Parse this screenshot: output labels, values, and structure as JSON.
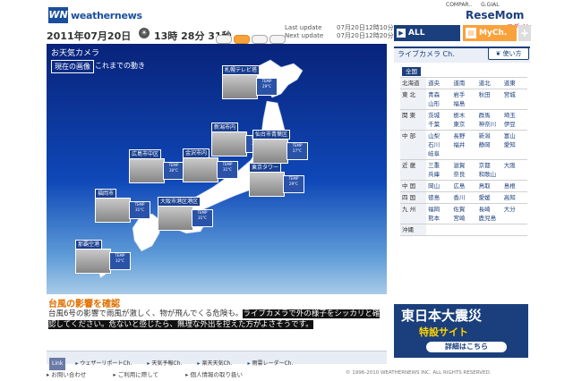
{
  "header": {
    "logo_mark": "WN",
    "logo_text": "weathernews",
    "top_links": [
      "COMPAR..",
      "G.GIAL"
    ],
    "brand": "ReseMom",
    "login": "ログイン",
    "date": "2011年07月20日",
    "time": "13時 28分 31秒",
    "view_buttons": [
      "",
      "",
      "",
      ""
    ],
    "last_update_label": "Last update",
    "last_update_value": "07月20日12時10分",
    "next_update_label": "Next update",
    "next_update_value": "07月20日12時20分",
    "tabs": {
      "all": "ALL Channel",
      "my": "MyCh.",
      "plus": "+"
    }
  },
  "map": {
    "title": "お天気カメラ",
    "tab_current": "現在の画像",
    "tab_past": "これまでの動き",
    "cameras": [
      {
        "name": "札幌テレビ塔",
        "temp": "TEMP\n29°C"
      },
      {
        "name": "新潟市内",
        "temp": "TEMP\n31°C"
      },
      {
        "name": "仙台市青葉区",
        "temp": "TEMP\n27°C"
      },
      {
        "name": "広島市中区",
        "temp": "TEMP\n30°C"
      },
      {
        "name": "金沢市内",
        "temp": "TEMP\n31°C"
      },
      {
        "name": "東京タワー",
        "temp": "TEMP\n29°C"
      },
      {
        "name": "福岡市",
        "temp": "TEMP\n31°C"
      },
      {
        "name": "大阪市港区港区",
        "temp": "TEMP\n31°C"
      },
      {
        "name": "那覇空港",
        "temp": "TEMP\n32°C"
      }
    ]
  },
  "news": {
    "title": "台風の影響を確認",
    "body_plain": "台風6号の影響で雨風が激しく、物が飛んでくる危険も。",
    "body_highlight": "ライブカメラで外の様子をシッカリと確認してください。危ないと感じたら、無理な外出を控えた方がよさそうです。"
  },
  "bottom_nav": {
    "link_label": "Link",
    "items": [
      "ウェザーリポートCh.",
      "天気予報Ch.",
      "楽天天気Ch.",
      "雨雲レーダーCh."
    ]
  },
  "footer": {
    "links": [
      "お問い合わせ",
      "ご利用に際して",
      "個人情報の取り扱い"
    ],
    "copyright": "© 1996-2010 WEATHERNEWS INC. ALL RIGHTS RESERVED."
  },
  "sidebar": {
    "title": "ライブカメラ Ch.",
    "howto": "使い方",
    "all_label": "全国",
    "regions": [
      {
        "region": "北海道",
        "cities": [
          "道央",
          "道南",
          "道北",
          "道東"
        ]
      },
      {
        "region": "東 北",
        "cities": [
          "青森",
          "岩手",
          "秋田",
          "宮城",
          "山形",
          "福島"
        ]
      },
      {
        "region": "関 東",
        "cities": [
          "茨城",
          "栃木",
          "群馬",
          "埼玉",
          "千葉",
          "東京",
          "神奈川",
          "伊豆"
        ]
      },
      {
        "region": "中 部",
        "cities": [
          "山梨",
          "長野",
          "新潟",
          "富山",
          "石川",
          "福井",
          "静岡",
          "愛知",
          "岐阜"
        ]
      },
      {
        "region": "近 畿",
        "cities": [
          "三重",
          "滋賀",
          "京都",
          "大阪",
          "兵庫",
          "奈良",
          "和歌山"
        ]
      },
      {
        "region": "中 国",
        "cities": [
          "岡山",
          "広島",
          "鳥取",
          "島根"
        ]
      },
      {
        "region": "四 国",
        "cities": [
          "徳島",
          "香川",
          "愛媛",
          "高知"
        ]
      },
      {
        "region": "九 州",
        "cities": [
          "福岡",
          "佐賀",
          "長崎",
          "大分",
          "熊本",
          "宮崎",
          "鹿児島"
        ]
      },
      {
        "region": "沖縄",
        "cities": []
      }
    ]
  },
  "banner": {
    "line1": "東日本大震災",
    "line2": "特設サイト",
    "line3": "詳細はこちら"
  },
  "colors": {
    "brand_blue": "#1b3f7c",
    "accent_orange": "#f9a23c"
  }
}
